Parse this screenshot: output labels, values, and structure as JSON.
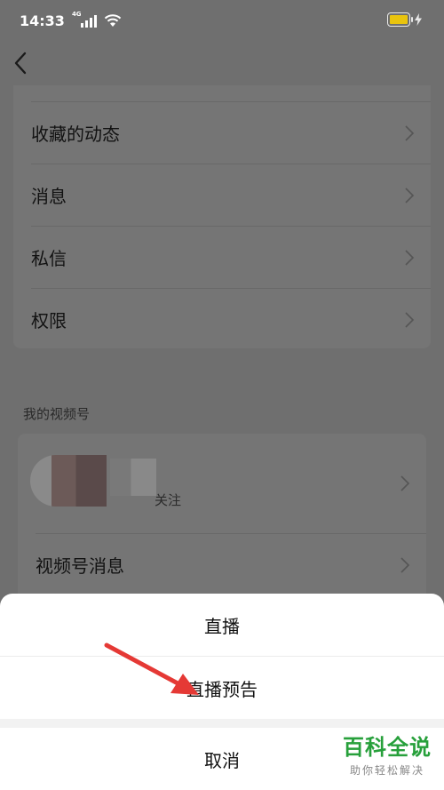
{
  "status_bar": {
    "time": "14:33",
    "network": "4G"
  },
  "settings_list": {
    "items": [
      {
        "label": "收藏的动态"
      },
      {
        "label": "消息"
      },
      {
        "label": "私信"
      },
      {
        "label": "权限"
      }
    ]
  },
  "channel_section": {
    "title": "我的视频号",
    "follow_label": "关注",
    "messages_label": "视频号消息"
  },
  "action_sheet": {
    "options": [
      "直播",
      "直播预告"
    ],
    "cancel_label": "取消"
  },
  "watermark": {
    "title": "百科全说",
    "subtitle": "助你轻松解决"
  },
  "colors": {
    "battery": "#e9c40e",
    "arrow": "#e53935",
    "watermark": "#27a03b"
  }
}
